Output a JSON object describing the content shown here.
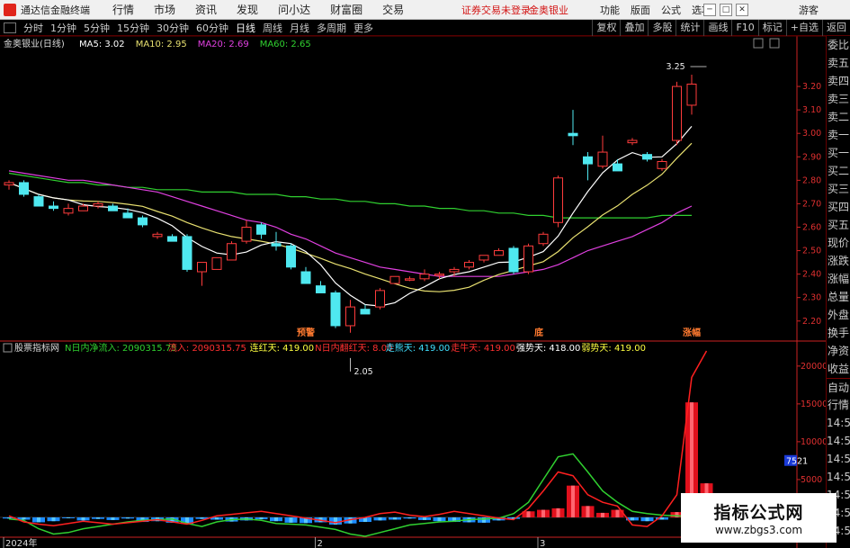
{
  "app": {
    "name": "通达信金融终端",
    "menu": [
      "行情",
      "市场",
      "资讯",
      "发现",
      "问小达",
      "财富圈",
      "交易"
    ],
    "notice": "证券交易未登录",
    "notice2": "金奥银业",
    "right_menu": [
      "功能",
      "版面",
      "公式",
      "选项"
    ],
    "guest": "游客",
    "window_buttons": [
      "─",
      "□",
      "✕"
    ]
  },
  "toolbar": {
    "periods": [
      "分时",
      "1分钟",
      "5分钟",
      "15分钟",
      "30分钟",
      "60分钟",
      "日线",
      "周线",
      "月线",
      "多周期",
      "更多"
    ],
    "active": "日线",
    "right_tools": [
      "复权",
      "叠加",
      "多股",
      "统计",
      "画线",
      "F10",
      "标记",
      "+自选",
      "返回"
    ]
  },
  "panel": {
    "title": "金奥银业(日线)",
    "ma": [
      {
        "label": "MA5: 3.02",
        "color": "#ffffff"
      },
      {
        "label": "MA10: 2.95",
        "color": "#e8e070"
      },
      {
        "label": "MA20: 2.69",
        "color": "#e040e0"
      },
      {
        "label": "MA60: 2.65",
        "color": "#30d030"
      }
    ]
  },
  "indicator": {
    "title": "股票指标网",
    "items": [
      {
        "label": "N日内净流入: 2090315.75",
        "color": "#30d030"
      },
      {
        "label": "流入: 2090315.75",
        "color": "#ff3030"
      },
      {
        "label": "连红天: 419.00",
        "color": "#ffff40"
      },
      {
        "label": "N日内翻红天: 8.00",
        "color": "#ff3030"
      },
      {
        "label": "走熊天: 419.00",
        "color": "#40e0ff"
      },
      {
        "label": "走牛天: 419.00",
        "color": "#ff3030"
      },
      {
        "label": "强势天: 418.00",
        "color": "#ffffff"
      },
      {
        "label": "弱势天: 419.00",
        "color": "#ffff40"
      }
    ]
  },
  "colors": {
    "up": "#ff3c3c",
    "down": "#4fe8f0",
    "ma5": "#ffffff",
    "ma10": "#e8e070",
    "ma20": "#e040e0",
    "ma60": "#30d030",
    "axis": "#cc2222"
  },
  "chart_data": [
    {
      "type": "candlestick",
      "title": "金奥银业(日线)",
      "y_ticks": [
        2.2,
        2.3,
        2.4,
        2.5,
        2.6,
        2.7,
        2.8,
        2.9,
        3.0,
        3.1,
        3.2
      ],
      "ylim": [
        2.13,
        3.3
      ],
      "x_labels": [
        {
          "label": "2024年",
          "i": 0
        },
        {
          "label": "2",
          "i": 21
        },
        {
          "label": "3",
          "i": 36
        }
      ],
      "annotations": [
        {
          "text": "3.25",
          "i": 47,
          "price": 3.25
        },
        {
          "text": "2.05",
          "i": 23,
          "price": 2.05
        },
        {
          "text": "预警",
          "i": 20
        },
        {
          "text": "底",
          "i": 36
        },
        {
          "text": "涨幅",
          "i": 46
        }
      ],
      "ohlc": [
        [
          2.78,
          2.8,
          2.76,
          2.79
        ],
        [
          2.79,
          2.8,
          2.73,
          2.74
        ],
        [
          2.73,
          2.74,
          2.69,
          2.69
        ],
        [
          2.69,
          2.71,
          2.67,
          2.68
        ],
        [
          2.66,
          2.7,
          2.65,
          2.68
        ],
        [
          2.67,
          2.7,
          2.67,
          2.69
        ],
        [
          2.69,
          2.71,
          2.68,
          2.7
        ],
        [
          2.69,
          2.7,
          2.67,
          2.67
        ],
        [
          2.66,
          2.68,
          2.64,
          2.64
        ],
        [
          2.64,
          2.65,
          2.6,
          2.61
        ],
        [
          2.56,
          2.58,
          2.55,
          2.57
        ],
        [
          2.56,
          2.57,
          2.54,
          2.54
        ],
        [
          2.56,
          2.57,
          2.41,
          2.42
        ],
        [
          2.41,
          2.44,
          2.35,
          2.45
        ],
        [
          2.42,
          2.47,
          2.42,
          2.47
        ],
        [
          2.46,
          2.54,
          2.46,
          2.53
        ],
        [
          2.54,
          2.63,
          2.53,
          2.6
        ],
        [
          2.61,
          2.62,
          2.55,
          2.57
        ],
        [
          2.53,
          2.58,
          2.5,
          2.52
        ],
        [
          2.52,
          2.53,
          2.42,
          2.43
        ],
        [
          2.41,
          2.43,
          2.36,
          2.36
        ],
        [
          2.35,
          2.37,
          2.32,
          2.32
        ],
        [
          2.32,
          2.33,
          2.17,
          2.18
        ],
        [
          2.18,
          2.29,
          2.15,
          2.26
        ],
        [
          2.25,
          2.27,
          2.23,
          2.23
        ],
        [
          2.26,
          2.34,
          2.25,
          2.33
        ],
        [
          2.36,
          2.39,
          2.36,
          2.39
        ],
        [
          2.38,
          2.39,
          2.37,
          2.38
        ],
        [
          2.38,
          2.42,
          2.37,
          2.4
        ],
        [
          2.4,
          2.41,
          2.38,
          2.4
        ],
        [
          2.41,
          2.43,
          2.39,
          2.42
        ],
        [
          2.43,
          2.46,
          2.42,
          2.45
        ],
        [
          2.46,
          2.48,
          2.45,
          2.48
        ],
        [
          2.48,
          2.51,
          2.48,
          2.5
        ],
        [
          2.51,
          2.52,
          2.4,
          2.41
        ],
        [
          2.41,
          2.53,
          2.4,
          2.52
        ],
        [
          2.53,
          2.58,
          2.52,
          2.57
        ],
        [
          2.62,
          2.82,
          2.6,
          2.81
        ],
        [
          3.0,
          3.1,
          2.95,
          2.99
        ],
        [
          2.9,
          2.92,
          2.8,
          2.87
        ],
        [
          2.86,
          2.99,
          2.85,
          2.92
        ],
        [
          2.87,
          2.89,
          2.84,
          2.84
        ],
        [
          2.96,
          2.98,
          2.95,
          2.97
        ],
        [
          2.91,
          2.92,
          2.88,
          2.89
        ],
        [
          2.85,
          2.89,
          2.84,
          2.88
        ],
        [
          2.97,
          3.22,
          2.95,
          3.2
        ],
        [
          3.12,
          3.25,
          3.08,
          3.21
        ]
      ]
    },
    {
      "type": "bar+line",
      "title": "股票指标网",
      "y_ticks": [
        5000,
        10000,
        15000,
        20000
      ],
      "ylim": [
        -2500,
        22000
      ],
      "current_value": "7521",
      "bars": [
        -150,
        -300,
        -650,
        -500,
        -100,
        -400,
        -200,
        -350,
        -150,
        -600,
        -500,
        -700,
        -850,
        -200,
        -300,
        -550,
        -400,
        -250,
        -500,
        -700,
        -750,
        -650,
        -950,
        -800,
        -600,
        -400,
        -300,
        -150,
        -350,
        -500,
        -600,
        -650,
        -700,
        -400,
        -200,
        800,
        1000,
        1200,
        4200,
        1500,
        600,
        1000,
        -400,
        -500,
        -300,
        700,
        15200,
        4500
      ],
      "red_line": [
        200,
        -600,
        -900,
        -1100,
        -800,
        -500,
        -700,
        -900,
        -700,
        -500,
        -300,
        -600,
        -900,
        -400,
        200,
        400,
        600,
        800,
        500,
        200,
        -100,
        -400,
        -700,
        -300,
        0,
        500,
        700,
        300,
        100,
        400,
        800,
        500,
        200,
        -100,
        -300,
        1200,
        3500,
        6000,
        5500,
        3000,
        2000,
        1500,
        -1000,
        -1200,
        200,
        3000,
        18500,
        22000
      ],
      "green_line": [
        -200,
        -400,
        -1500,
        -2200,
        -2000,
        -1500,
        -1200,
        -900,
        -600,
        -400,
        -300,
        -200,
        -800,
        -1200,
        -600,
        -300,
        -200,
        -400,
        -800,
        -900,
        -1000,
        -1300,
        -1600,
        -2200,
        -2500,
        -2000,
        -1500,
        -1000,
        -800,
        -600,
        -500,
        -300,
        -200,
        -100,
        500,
        2000,
        5000,
        8000,
        8400,
        6000,
        3500,
        2000,
        800,
        500,
        300,
        200,
        100,
        0
      ]
    }
  ]
}
